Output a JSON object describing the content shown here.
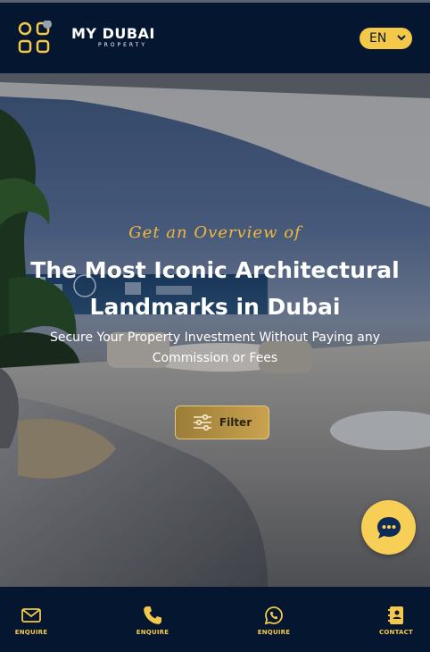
{
  "header": {
    "logo_title": "MY DUBAI",
    "logo_subtitle": "PROPERTY",
    "language": "EN",
    "colors": {
      "background": "#041630",
      "accent": "#f4c94a"
    }
  },
  "hero": {
    "eyebrow": "Get an Overview of",
    "headline_line1": "The Most Iconic Architectural",
    "headline_line2": "Landmarks in Dubai",
    "subline_line1": "Secure Your Property Investment Without Paying any",
    "subline_line2": "Commission or Fees",
    "filter_label": "Filter"
  },
  "chat": {
    "icon": "chat-bubble-icon"
  },
  "bottom_nav": {
    "items": [
      {
        "label": "ENQUIRE",
        "icon": "envelope-icon"
      },
      {
        "label": "ENQUIRE",
        "icon": "phone-icon"
      },
      {
        "label": "ENQUIRE",
        "icon": "whatsapp-icon"
      },
      {
        "label": "CONTACT",
        "icon": "contact-book-icon"
      }
    ]
  }
}
